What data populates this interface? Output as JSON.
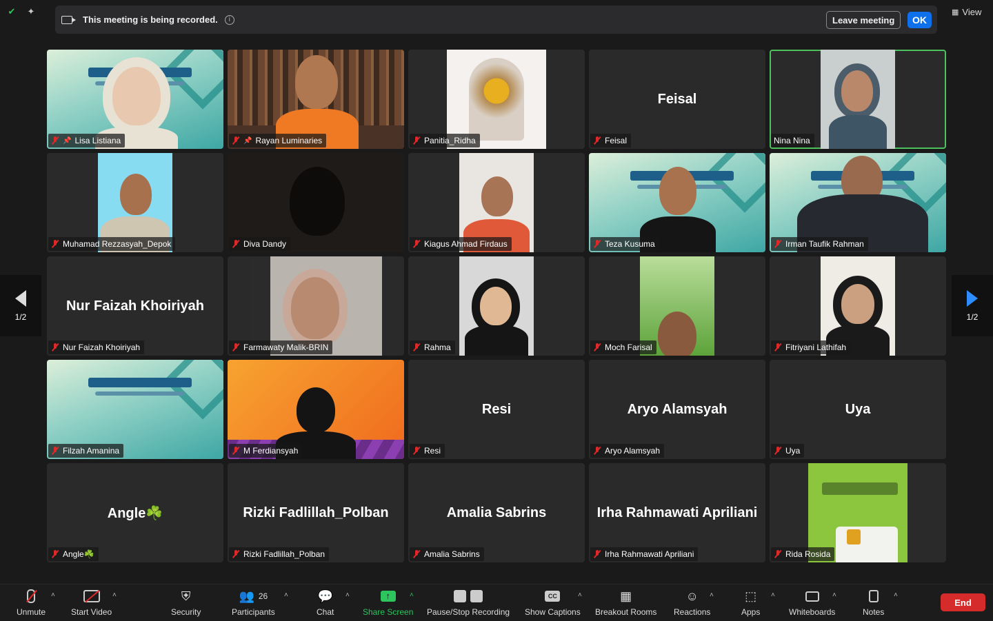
{
  "banner": {
    "recording_text": "This meeting is being recorded.",
    "leave_label": "Leave meeting",
    "ok_label": "OK"
  },
  "view_label": "View",
  "page_indicator": {
    "left": "1/2",
    "right": "1/2"
  },
  "participants": [
    {
      "name": "Lisa Listiana",
      "pinned": true
    },
    {
      "name": "Rayan Luminaries",
      "pinned": true
    },
    {
      "name": "Panitia_Ridha"
    },
    {
      "name": "Feisal",
      "display": "Feisal"
    },
    {
      "name": "Nina Nina",
      "active": true
    },
    {
      "name": "Muhamad Rezzasyah_Depok"
    },
    {
      "name": "Diva Dandy"
    },
    {
      "name": "Kiagus Ahmad Firdaus"
    },
    {
      "name": "Teza Kusuma"
    },
    {
      "name": "Irman Taufik Rahman"
    },
    {
      "name": "Nur Faizah Khoiriyah",
      "display": "Nur Faizah Khoiriyah"
    },
    {
      "name": "Farmawaty Malik-BRIN"
    },
    {
      "name": "Rahma"
    },
    {
      "name": "Moch Farisal"
    },
    {
      "name": "Fitriyani Lathifah"
    },
    {
      "name": "Filzah Amanina"
    },
    {
      "name": "M Ferdiansyah"
    },
    {
      "name": "Resi",
      "display": "Resi"
    },
    {
      "name": "Aryo Alamsyah",
      "display": "Aryo Alamsyah"
    },
    {
      "name": "Uya",
      "display": "Uya"
    },
    {
      "name": "Angle☘️",
      "display": "Angle☘️"
    },
    {
      "name": "Rizki Fadlillah_Polban",
      "display": "Rizki Fadlillah_Polban"
    },
    {
      "name": "Amalia Sabrins",
      "display": "Amalia Sabrins"
    },
    {
      "name": "Irha Rahmawati Apriliani",
      "display": "Irha Rahmawati Apriliani"
    },
    {
      "name": "Rida Rosida"
    }
  ],
  "toolbar": {
    "unmute": "Unmute",
    "start_video": "Start Video",
    "security": "Security",
    "participants": "Participants",
    "participant_count": "26",
    "chat": "Chat",
    "share_screen": "Share Screen",
    "recording": "Pause/Stop Recording",
    "captions": "Show Captions",
    "breakout": "Breakout Rooms",
    "reactions": "Reactions",
    "apps": "Apps",
    "whiteboards": "Whiteboards",
    "notes": "Notes",
    "end": "End"
  },
  "colors": {
    "accent": "#0e71eb",
    "end": "#d52b2b",
    "share": "#2dc55e",
    "active_speaker": "#4cc15d",
    "muted": "#e02828"
  }
}
